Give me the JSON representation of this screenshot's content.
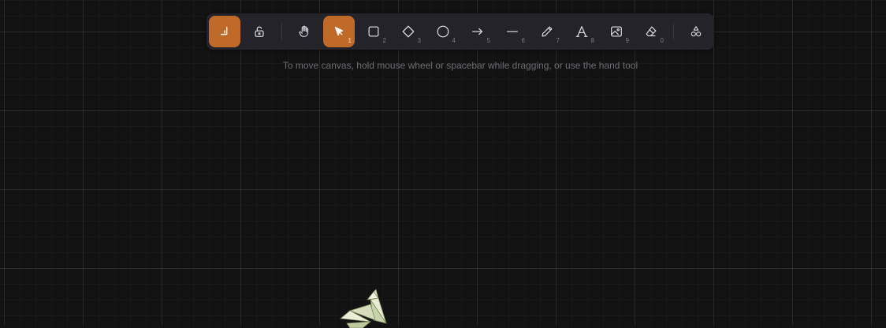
{
  "toolbar": {
    "tools": [
      {
        "name": "keep-tool-active",
        "icon": "lock-arrow-icon",
        "key": "",
        "active": true
      },
      {
        "name": "lock",
        "icon": "lock-open-icon",
        "key": "",
        "active": false
      },
      {
        "name": "hand",
        "icon": "hand-icon",
        "key": "",
        "active": false
      },
      {
        "name": "selection",
        "icon": "pointer-icon",
        "key": "1",
        "active": true
      },
      {
        "name": "rectangle",
        "icon": "square-icon",
        "key": "2",
        "active": false
      },
      {
        "name": "diamond",
        "icon": "diamond-icon",
        "key": "3",
        "active": false
      },
      {
        "name": "ellipse",
        "icon": "circle-icon",
        "key": "4",
        "active": false
      },
      {
        "name": "arrow",
        "icon": "arrow-right-icon",
        "key": "5",
        "active": false
      },
      {
        "name": "line",
        "icon": "line-icon",
        "key": "6",
        "active": false
      },
      {
        "name": "draw",
        "icon": "pencil-icon",
        "key": "7",
        "active": false
      },
      {
        "name": "text",
        "icon": "text-icon",
        "key": "8",
        "active": false
      },
      {
        "name": "image",
        "icon": "image-icon",
        "key": "9",
        "active": false
      },
      {
        "name": "eraser",
        "icon": "eraser-icon",
        "key": "0",
        "active": false
      },
      {
        "name": "more-tools",
        "icon": "shapes-icon",
        "key": "",
        "active": false
      }
    ]
  },
  "hint": "To move canvas, hold mouse wheel or spacebar while dragging, or use the hand tool",
  "colors": {
    "accent": "#c06a2a",
    "toolbar_bg": "#232329",
    "canvas_bg": "#121212"
  }
}
